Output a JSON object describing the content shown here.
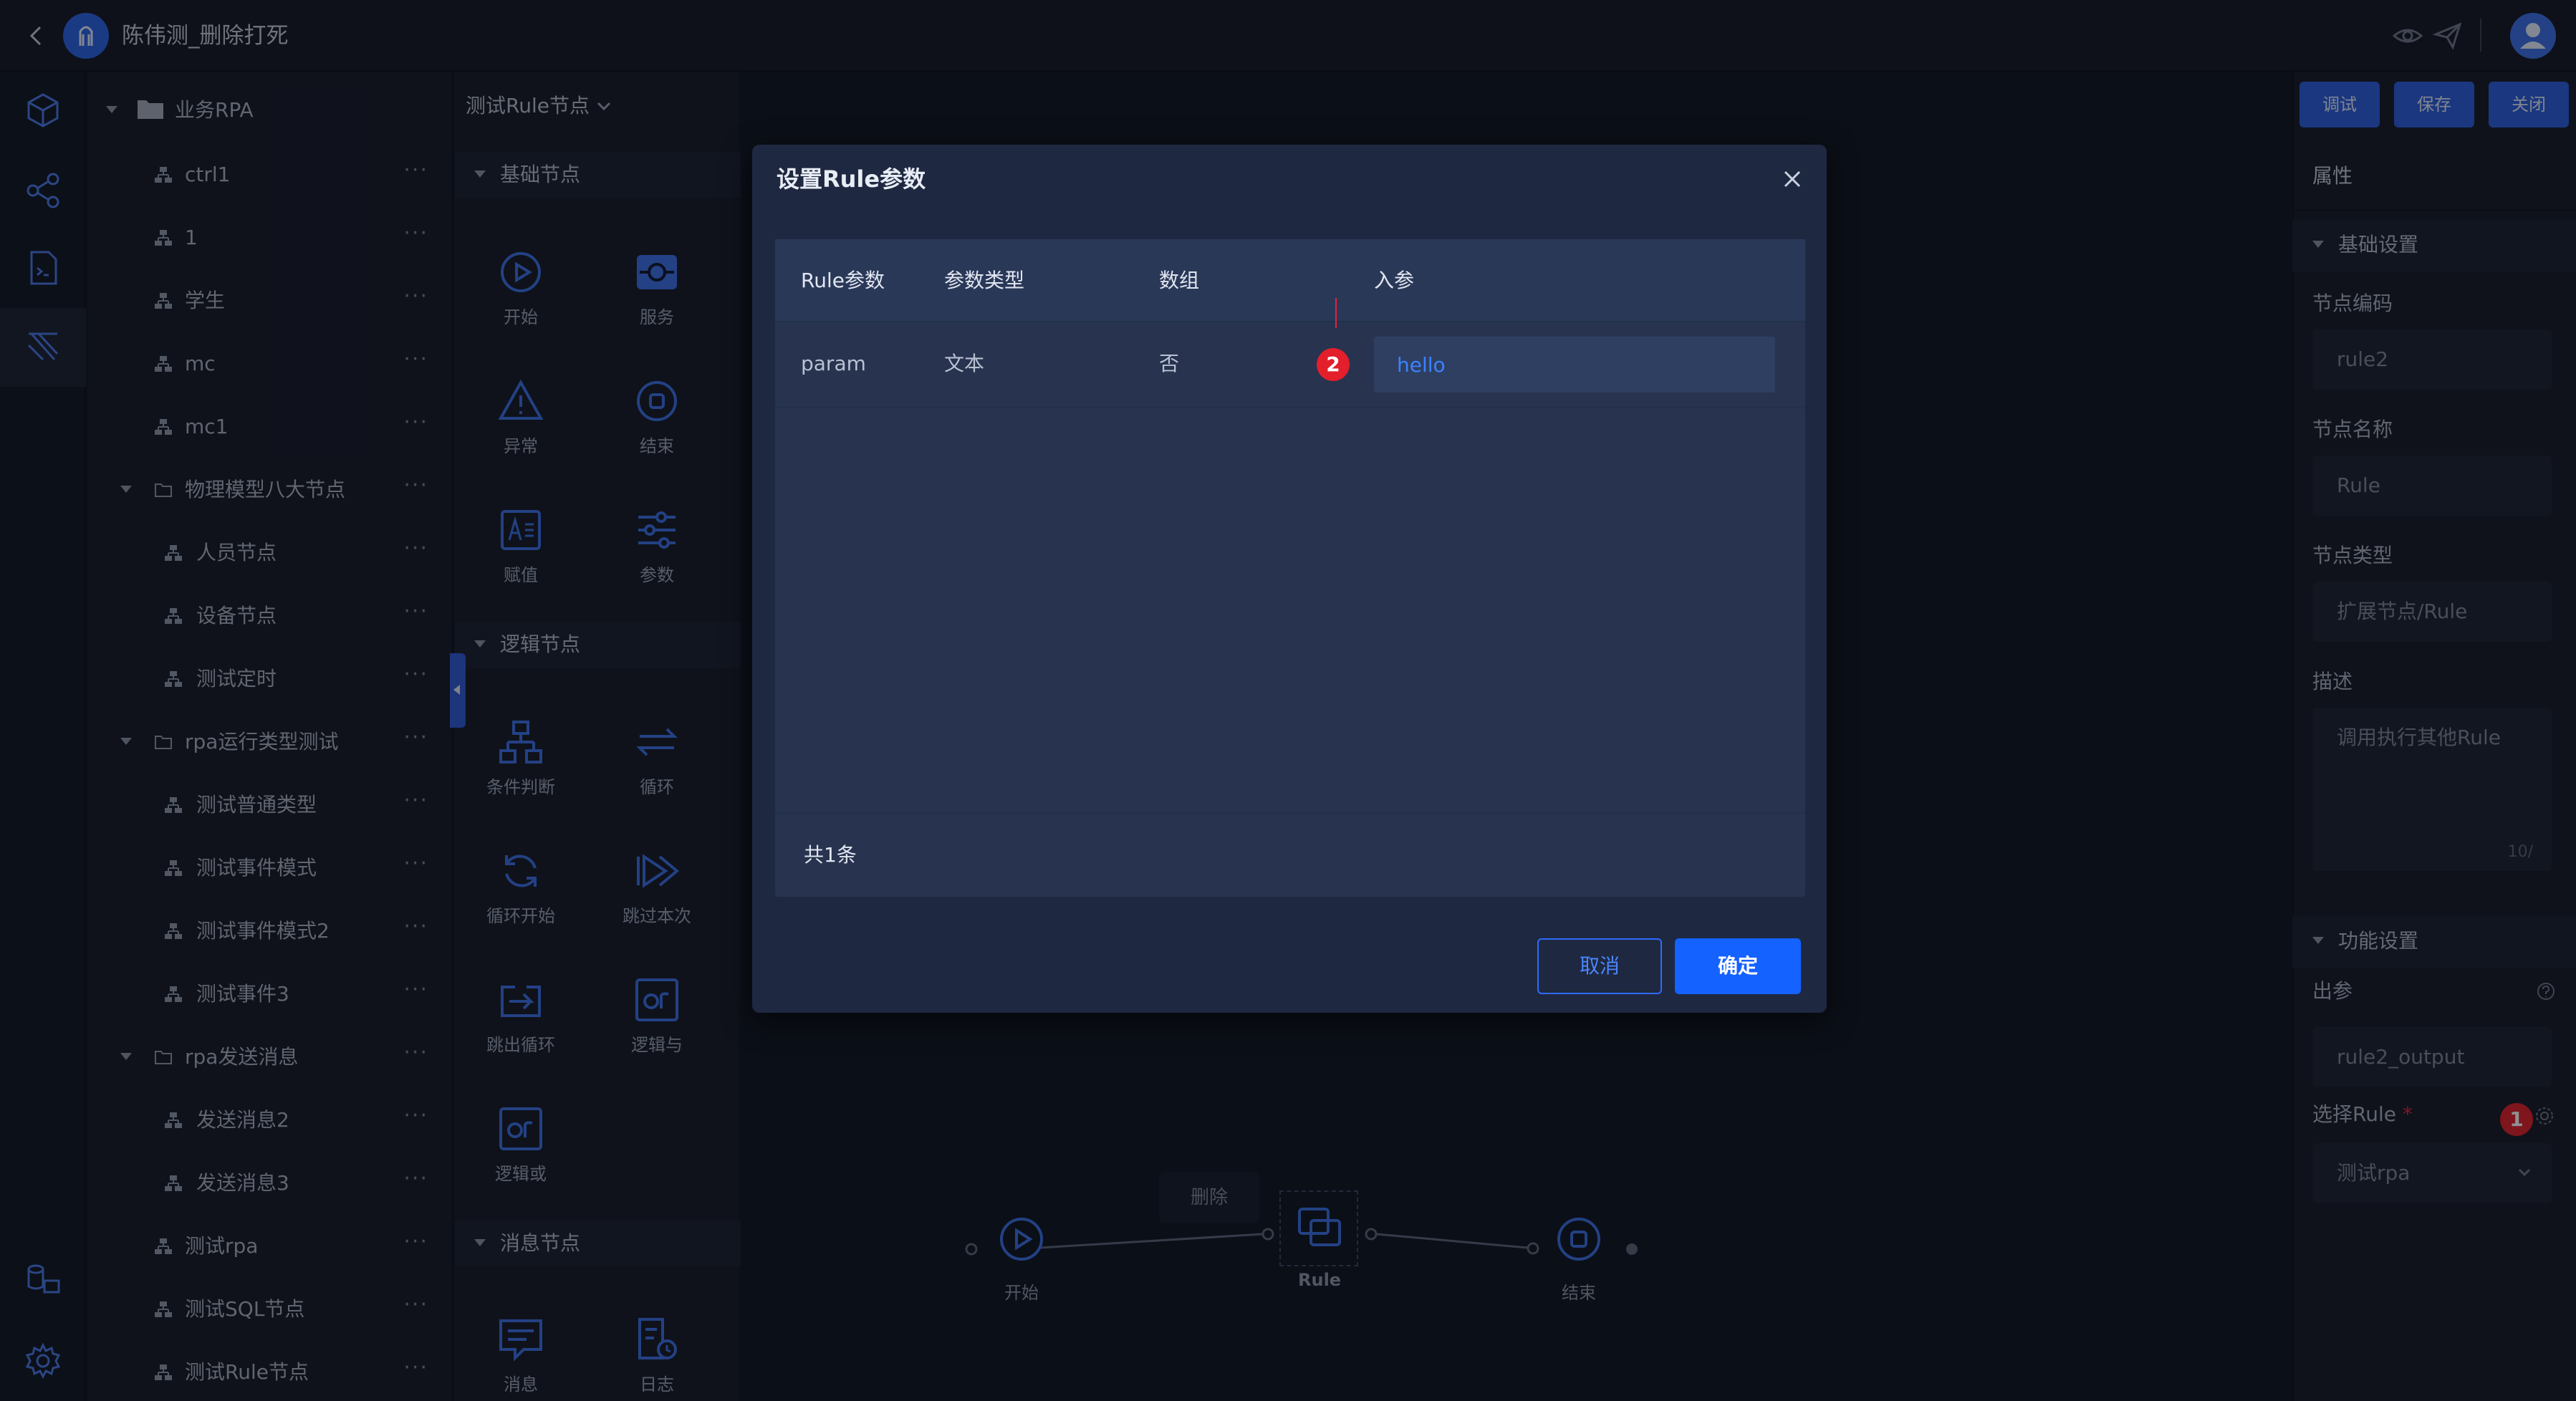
{
  "app": {
    "title": "陈伟测_删除打死"
  },
  "tree": {
    "root": "业务RPA",
    "items": [
      {
        "label": "ctrl1"
      },
      {
        "label": "1"
      },
      {
        "label": "学生"
      },
      {
        "label": "mc"
      },
      {
        "label": "mc1"
      },
      {
        "label": "物理模型八大节点"
      },
      {
        "label": "人员节点"
      },
      {
        "label": "设备节点"
      },
      {
        "label": "测试定时"
      },
      {
        "label": "rpa运行类型测试"
      },
      {
        "label": "测试普通类型"
      },
      {
        "label": "测试事件模式"
      },
      {
        "label": "测试事件模式2"
      },
      {
        "label": "测试事件3"
      },
      {
        "label": "rpa发送消息"
      },
      {
        "label": "发送消息2"
      },
      {
        "label": "发送消息3"
      },
      {
        "label": "测试rpa"
      },
      {
        "label": "测试SQL节点"
      },
      {
        "label": "测试Rule节点"
      }
    ],
    "more": "···"
  },
  "palette": {
    "current": "测试Rule节点",
    "sections": {
      "basic": "基础节点",
      "logic": "逻辑节点",
      "message": "消息节点"
    },
    "nodes": {
      "start": "开始",
      "service": "服务",
      "exception": "异常",
      "end": "结束",
      "assign": "赋值",
      "param": "参数",
      "condition": "条件判断",
      "loop": "循环",
      "loop_start": "循环开始",
      "skip": "跳过本次",
      "break": "跳出循环",
      "and": "逻辑与",
      "or": "逻辑或",
      "message": "消息",
      "log": "日志"
    }
  },
  "toolbar": {
    "debug": "调试",
    "save": "保存",
    "close": "关闭"
  },
  "props": {
    "title": "属性",
    "basic_section": "基础设置",
    "code_label": "节点编码",
    "code_value": "rule2",
    "name_label": "节点名称",
    "name_value": "Rule",
    "type_label": "节点类型",
    "type_value": "扩展节点/Rule",
    "desc_label": "描述",
    "desc_value": "调用执行其他Rule",
    "desc_count": "10/",
    "func_section": "功能设置",
    "output_label": "出参",
    "output_value": "rule2_output",
    "rule_label": "选择Rule",
    "required_mark": "*",
    "rule_value": "测试rpa",
    "badge": "1"
  },
  "flow": {
    "delete_label": "删除",
    "start": "开始",
    "rule": "Rule",
    "end": "结束"
  },
  "modal": {
    "title": "设置Rule参数",
    "columns": [
      "Rule参数",
      "参数类型",
      "数组",
      "入参"
    ],
    "row": {
      "param": "param",
      "type": "文本",
      "array": "否",
      "value": "hello"
    },
    "badge": "2",
    "total": "共1条",
    "cancel": "取消",
    "confirm": "确定"
  },
  "colors": {
    "accent": "#1462ff",
    "badge": "#e21f2b",
    "modal_bg": "#1e2840"
  }
}
